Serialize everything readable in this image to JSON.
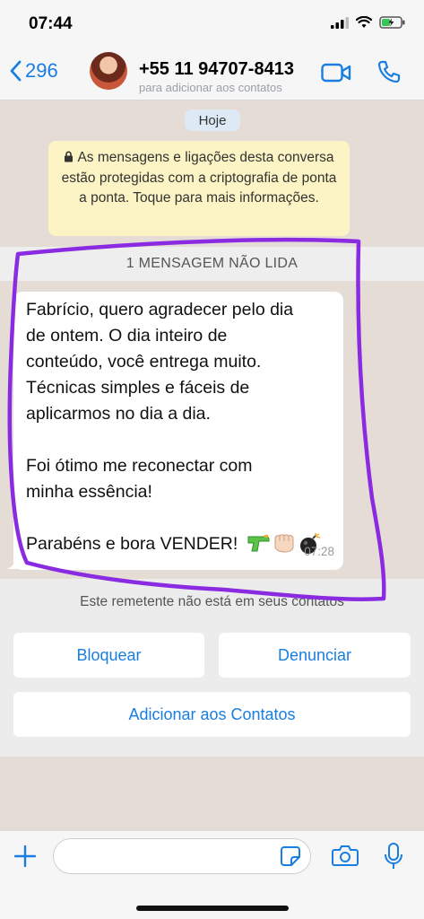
{
  "status_bar": {
    "time": "07:44"
  },
  "header": {
    "back_count": "296",
    "contact_number": "+55 11 94707-8413",
    "subtitle": "para adicionar aos contatos"
  },
  "chat": {
    "date_chip": "Hoje",
    "encryption_notice": "As mensagens e ligações desta conversa estão protegidas com a criptografia de ponta a ponta. Toque para mais informações.",
    "unread_banner": "1 MENSAGEM NÃO LIDA",
    "message": {
      "lines": [
        "Fabrício, quero agradecer pelo dia",
        "de ontem. O dia inteiro de",
        "conteúdo, você entrega muito.",
        "Técnicas simples e fáceis de",
        "aplicarmos no dia a dia.",
        "",
        "Foi ótimo me reconectar com",
        "minha essência!",
        "",
        "Parabéns e bora VENDER!"
      ],
      "emojis": [
        "water-pistol",
        "fist",
        "bomb"
      ],
      "time": "07:28"
    },
    "sender_notice": "Este remetente não está em seus contatos"
  },
  "actions": {
    "block": "Bloquear",
    "report": "Denunciar",
    "add_contact": "Adicionar aos Contatos"
  },
  "input": {
    "value": "",
    "placeholder": ""
  },
  "colors": {
    "accent": "#1a7ee0",
    "chat_background": "#e5ddd5",
    "notice_background": "#fcf4c4",
    "annotation": "#8a2be2"
  }
}
